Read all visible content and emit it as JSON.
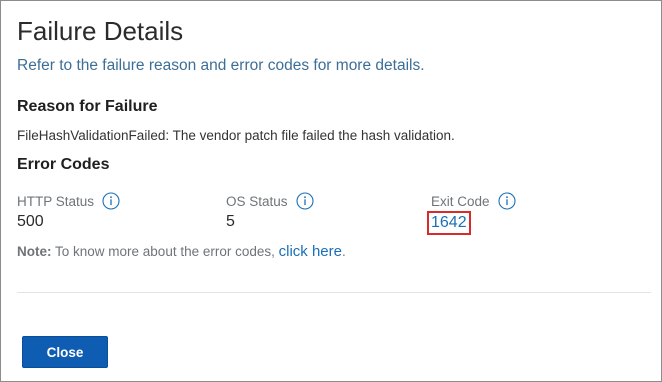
{
  "dialog": {
    "title": "Failure Details",
    "subtitle": "Refer to the failure reason and error codes for more details."
  },
  "reason": {
    "heading": "Reason for Failure",
    "text": "FileHashValidationFailed: The vendor patch file failed the hash validation."
  },
  "error_codes": {
    "heading": "Error Codes",
    "http": {
      "label": "HTTP Status",
      "value": "500",
      "icon": "info-icon"
    },
    "os": {
      "label": "OS Status",
      "value": "5",
      "icon": "info-icon"
    },
    "exit": {
      "label": "Exit Code",
      "value": "1642",
      "icon": "info-icon"
    }
  },
  "note": {
    "prefix": "Note:",
    "text": " To know more about the error codes, ",
    "link": "click here",
    "suffix": "."
  },
  "footer": {
    "close_label": "Close"
  },
  "colors": {
    "accent": "#0e5db3",
    "link": "#1a6fb8",
    "subtitle": "#3d6e96",
    "highlight_border": "#d92a2a"
  }
}
